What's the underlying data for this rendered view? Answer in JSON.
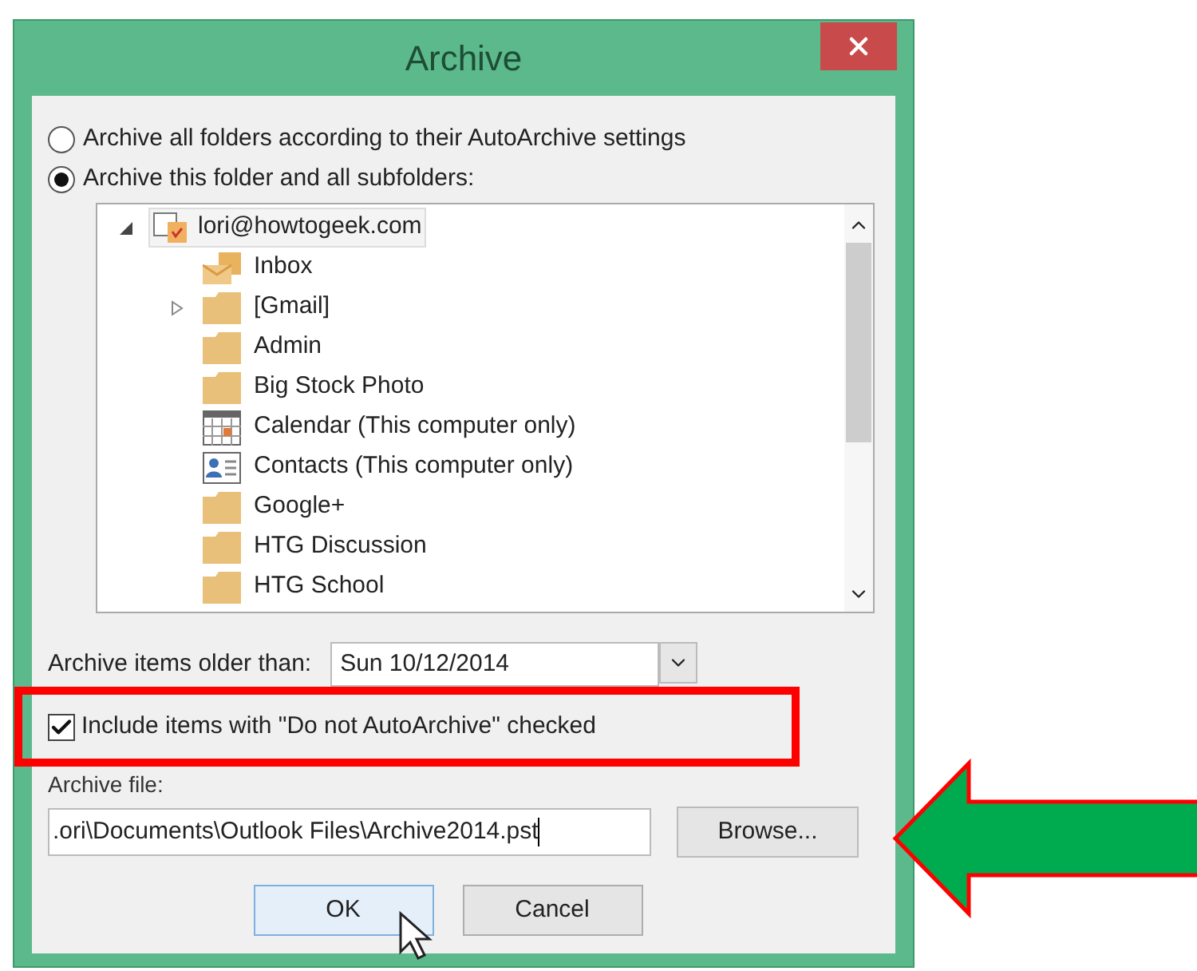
{
  "window": {
    "title": "Archive"
  },
  "options": [
    {
      "label": "Archive all folders according to their AutoArchive settings",
      "selected": false
    },
    {
      "label": "Archive this folder and all subfolders:",
      "selected": true
    }
  ],
  "tree": {
    "label": "lori@howtogeek.com",
    "expanded": true,
    "children": [
      {
        "label": "Inbox",
        "kind": "inbox",
        "has_children": false
      },
      {
        "label": "[Gmail]",
        "kind": "folder",
        "has_children": true
      },
      {
        "label": "Admin",
        "kind": "folder",
        "has_children": false
      },
      {
        "label": "Big Stock Photo",
        "kind": "folder",
        "has_children": false
      },
      {
        "label": "Calendar (This computer only)",
        "kind": "calendar",
        "has_children": false
      },
      {
        "label": "Contacts (This computer only)",
        "kind": "contacts",
        "has_children": false
      },
      {
        "label": "Google+",
        "kind": "folder",
        "has_children": false
      },
      {
        "label": "HTG Discussion",
        "kind": "folder",
        "has_children": false
      },
      {
        "label": "HTG School",
        "kind": "folder",
        "has_children": false
      }
    ]
  },
  "older_than": {
    "label": "Archive items older than:",
    "value": "Sun 10/12/2014"
  },
  "include_checkbox": {
    "label": "Include items with \"Do not AutoArchive\" checked",
    "checked": true
  },
  "archive_file": {
    "label": "Archive file:",
    "value": ".ori\\Documents\\Outlook Files\\Archive2014.pst"
  },
  "browse_button": {
    "label": "Browse..."
  },
  "buttons": [
    {
      "label": "OK",
      "hovered": true
    },
    {
      "label": "Cancel",
      "hovered": false
    }
  ]
}
